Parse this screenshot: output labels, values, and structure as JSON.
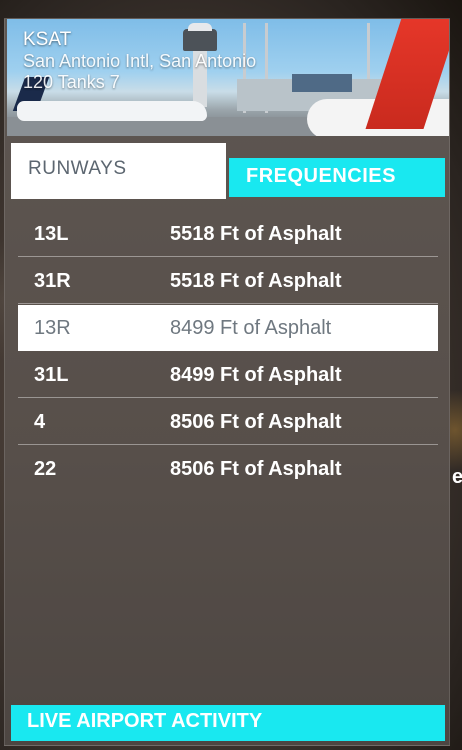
{
  "airport": {
    "icao": "KSAT",
    "name": "San Antonio Intl, San Antonio",
    "meta": "120 Tanks 7"
  },
  "tabs": [
    {
      "label": "RUNWAYS",
      "active": true
    },
    {
      "label": "FREQUENCIES",
      "active": false
    }
  ],
  "runways": [
    {
      "name": "13L",
      "description": "5518 Ft of Asphalt",
      "selected": false
    },
    {
      "name": "31R",
      "description": "5518 Ft of Asphalt",
      "selected": false
    },
    {
      "name": "13R",
      "description": "8499 Ft of Asphalt",
      "selected": true
    },
    {
      "name": "31L",
      "description": "8499 Ft of Asphalt",
      "selected": false
    },
    {
      "name": "4",
      "description": "8506 Ft of Asphalt",
      "selected": false
    },
    {
      "name": "22",
      "description": "8506 Ft of Asphalt",
      "selected": false
    }
  ],
  "footer": {
    "label": "LIVE AIRPORT ACTIVITY"
  },
  "edge_text": "e",
  "colors": {
    "accent": "#19e8f0",
    "selected_bg": "#ffffff",
    "panel": "#5a524d"
  }
}
